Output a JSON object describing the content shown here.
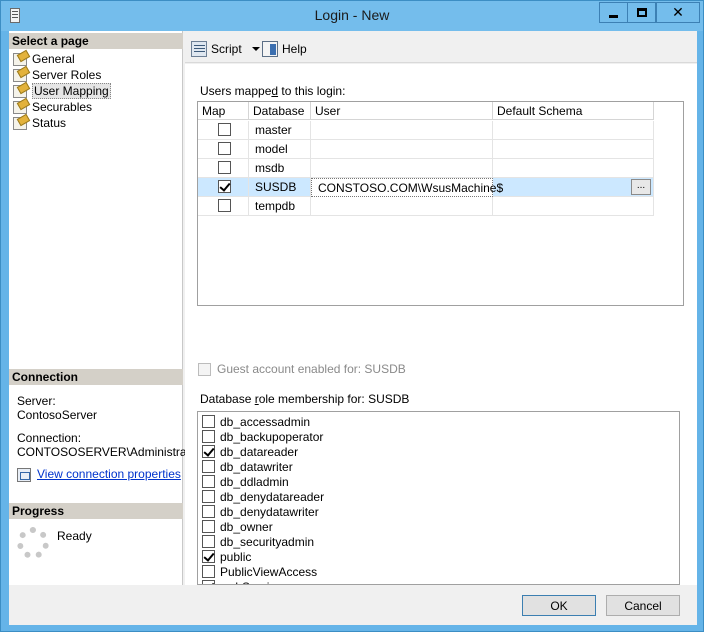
{
  "window": {
    "title": "Login - New"
  },
  "left_pane": {
    "select_page_header": "Select a page",
    "pages": [
      {
        "label": "General",
        "selected": false
      },
      {
        "label": "Server Roles",
        "selected": false
      },
      {
        "label": "User Mapping",
        "selected": true
      },
      {
        "label": "Securables",
        "selected": false
      },
      {
        "label": "Status",
        "selected": false
      }
    ],
    "connection_header": "Connection",
    "server_label": "Server:",
    "server_value": "ContosoServer",
    "connection_label": "Connection:",
    "connection_value": "CONTOSOSERVER\\Administrator",
    "view_connection_link": "View connection properties",
    "progress_header": "Progress",
    "progress_status": "Ready"
  },
  "toolbar": {
    "script_label": "Script",
    "help_label": "Help"
  },
  "mapping": {
    "label_pre": "Users mappe",
    "label_ul": "d",
    "label_post": " to this login:",
    "columns": [
      "Map",
      "Database",
      "User",
      "Default Schema"
    ],
    "rows": [
      {
        "map": false,
        "database": "master",
        "user": "",
        "schema": ""
      },
      {
        "map": false,
        "database": "model",
        "user": "",
        "schema": ""
      },
      {
        "map": false,
        "database": "msdb",
        "user": "",
        "schema": ""
      },
      {
        "map": true,
        "database": "SUSDB",
        "user": "CONSTOSO.COM\\WsusMachine$",
        "schema": "",
        "selected": true
      },
      {
        "map": false,
        "database": "tempdb",
        "user": "",
        "schema": ""
      }
    ],
    "ellipsis": "..."
  },
  "guest": {
    "label": "Guest account enabled for: SUSDB",
    "checked": false
  },
  "roles": {
    "label_pre": "Database ",
    "label_ul": "r",
    "label_post": "ole membership for: SUSDB",
    "items": [
      {
        "label": "db_accessadmin",
        "checked": false
      },
      {
        "label": "db_backupoperator",
        "checked": false
      },
      {
        "label": "db_datareader",
        "checked": true
      },
      {
        "label": "db_datawriter",
        "checked": false
      },
      {
        "label": "db_ddladmin",
        "checked": false
      },
      {
        "label": "db_denydatareader",
        "checked": false
      },
      {
        "label": "db_denydatawriter",
        "checked": false
      },
      {
        "label": "db_owner",
        "checked": false
      },
      {
        "label": "db_securityadmin",
        "checked": false
      },
      {
        "label": "public",
        "checked": true
      },
      {
        "label": "PublicViewAccess",
        "checked": false
      },
      {
        "label": "webService",
        "checked": true
      }
    ]
  },
  "footer": {
    "ok_label": "OK",
    "cancel_label": "Cancel"
  }
}
